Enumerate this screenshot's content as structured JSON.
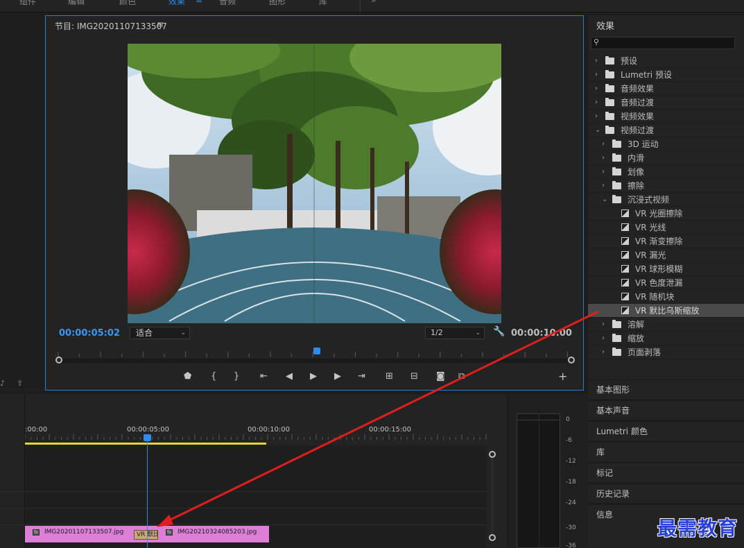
{
  "top_menu": [
    "组件",
    "编辑",
    "颜色",
    "效果",
    "音频",
    "图形",
    "库"
  ],
  "top_menu_active": "效果",
  "monitor": {
    "title": "节目: IMG20201107133507",
    "menu_icon": "≡",
    "timecode_current": "00:00:05:02",
    "timecode_duration": "00:00:10:00",
    "zoom_label": "适合",
    "resolution_label": "1/2"
  },
  "effects_panel": {
    "title": "效果",
    "search_value": "",
    "items": [
      {
        "label": "预设",
        "depth": 0,
        "kind": "preset-folder",
        "expanded": false
      },
      {
        "label": "Lumetri 预设",
        "depth": 0,
        "kind": "preset-folder",
        "expanded": false
      },
      {
        "label": "音频效果",
        "depth": 0,
        "kind": "folder",
        "expanded": false
      },
      {
        "label": "音频过渡",
        "depth": 0,
        "kind": "folder",
        "expanded": false
      },
      {
        "label": "视频效果",
        "depth": 0,
        "kind": "folder",
        "expanded": false
      },
      {
        "label": "视频过渡",
        "depth": 0,
        "kind": "folder",
        "expanded": true
      },
      {
        "label": "3D 运动",
        "depth": 1,
        "kind": "folder",
        "expanded": false
      },
      {
        "label": "内滑",
        "depth": 1,
        "kind": "folder",
        "expanded": false
      },
      {
        "label": "划像",
        "depth": 1,
        "kind": "folder",
        "expanded": false
      },
      {
        "label": "擦除",
        "depth": 1,
        "kind": "folder",
        "expanded": false
      },
      {
        "label": "沉浸式视频",
        "depth": 1,
        "kind": "folder",
        "expanded": true
      },
      {
        "label": "VR 光圈擦除",
        "depth": 2,
        "kind": "effect"
      },
      {
        "label": "VR 光线",
        "depth": 2,
        "kind": "effect"
      },
      {
        "label": "VR 渐变擦除",
        "depth": 2,
        "kind": "effect"
      },
      {
        "label": "VR 漏光",
        "depth": 2,
        "kind": "effect"
      },
      {
        "label": "VR 球形模糊",
        "depth": 2,
        "kind": "effect"
      },
      {
        "label": "VR 色度泄漏",
        "depth": 2,
        "kind": "effect"
      },
      {
        "label": "VR 随机块",
        "depth": 2,
        "kind": "effect"
      },
      {
        "label": "VR 默比乌斯缩放",
        "depth": 2,
        "kind": "effect",
        "selected": true
      },
      {
        "label": "溶解",
        "depth": 1,
        "kind": "folder",
        "expanded": false
      },
      {
        "label": "缩放",
        "depth": 1,
        "kind": "folder",
        "expanded": false
      },
      {
        "label": "页面剥落",
        "depth": 1,
        "kind": "folder",
        "expanded": false
      }
    ]
  },
  "side_panels": [
    "基本图形",
    "基本声音",
    "Lumetri 颜色",
    "库",
    "标记",
    "历史记录",
    "信息"
  ],
  "timeline": {
    "ruler_labels": [
      ":00:00",
      "00:00:05:00",
      "00:00:10:00",
      "00:00:15:00"
    ],
    "clip_a": "IMG20201107133507.jpg",
    "clip_b": "IMG20210324085203.jpg",
    "transition_label": "VR 默比"
  },
  "audio_meter": {
    "labels": [
      "0",
      "-6",
      "-12",
      "-18",
      "-24",
      "-30",
      "-36"
    ]
  },
  "watermark": "最需教育",
  "colors": {
    "accent": "#2d8ceb",
    "clip": "#dd7fd6",
    "work_area": "#e6d23d",
    "transition": "#c8a978",
    "annotation_arrow": "#e01e1e",
    "watermark": "#2a3fd4"
  },
  "icons": [
    "menu-icon",
    "search-icon",
    "wrench-icon",
    "marker-icon",
    "in-point-icon",
    "out-point-icon",
    "go-to-in-icon",
    "step-back-icon",
    "play-icon",
    "step-forward-icon",
    "go-to-out-icon",
    "insert-icon",
    "overwrite-icon",
    "camera-icon",
    "compare-icon",
    "add-icon",
    "folder-icon",
    "effect-icon",
    "chevron-right-icon",
    "chevron-down-icon"
  ]
}
